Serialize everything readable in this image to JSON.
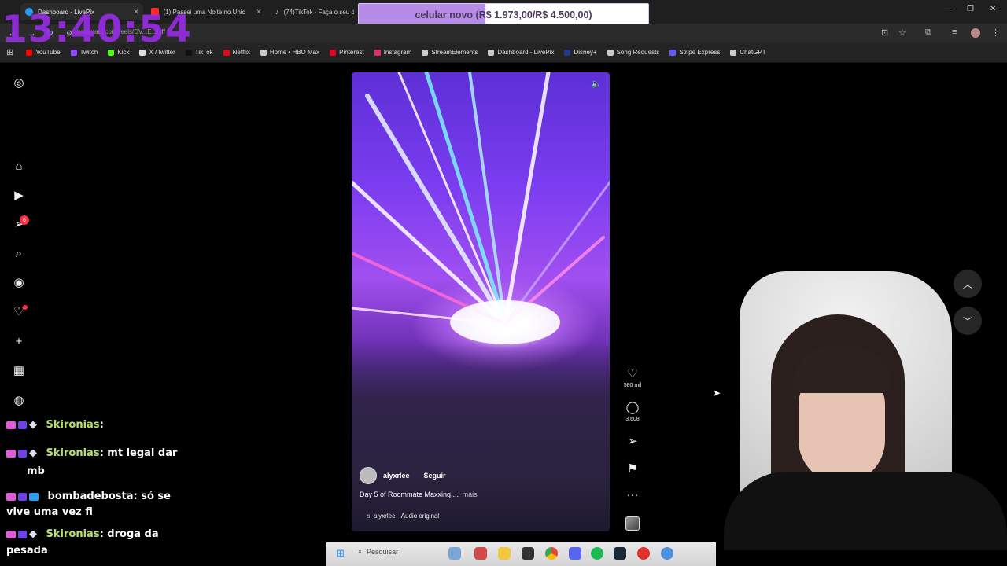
{
  "clock": "13:40:54",
  "browser": {
    "tabs": [
      {
        "title": "Dashboard - LivePix",
        "color": "#2b9bf4"
      },
      {
        "title": "(1) Passei uma Noite no Único",
        "color": "#ff2a2a"
      },
      {
        "title": "(74)TikTok - Faça o seu di",
        "color": "#222222"
      }
    ],
    "url": "instagram.com/reels/DV...E...Gf/"
  },
  "donation": {
    "text": "celular novo (R$ 1.973,00/R$ 4.500,00)",
    "progress_fraction": 0.4384,
    "fill_color": "#b78be8"
  },
  "bookmarks": [
    {
      "label": "YouTube",
      "color": "#ff0000"
    },
    {
      "label": "Twitch",
      "color": "#9146ff"
    },
    {
      "label": "Kick",
      "color": "#53fc18"
    },
    {
      "label": "X / twitter",
      "color": "#dddddd"
    },
    {
      "label": "TikTok",
      "color": "#111111"
    },
    {
      "label": "Netflix",
      "color": "#e50914"
    },
    {
      "label": "Home • HBO Max",
      "color": "#cccccc"
    },
    {
      "label": "Pinterest",
      "color": "#e60023"
    },
    {
      "label": "Instagram",
      "color": "#e1306c"
    },
    {
      "label": "StreamElements",
      "color": "#cccccc"
    },
    {
      "label": "Dashboard - LivePix",
      "color": "#cccccc"
    },
    {
      "label": "Disney+",
      "color": "#1a3a8c"
    },
    {
      "label": "Song Requests",
      "color": "#cccccc"
    },
    {
      "label": "Stripe Express",
      "color": "#635bff"
    },
    {
      "label": "ChatGPT",
      "color": "#cccccc"
    }
  ],
  "sidebar": {
    "notification_count": "6"
  },
  "reel": {
    "username": "alyxrlee",
    "follow_label": "Seguir",
    "caption": "Day 5 of Roommate Maxxing ...",
    "more_label": "mais",
    "audio": "alyxrlee · Áudio original",
    "likes": "580 mil",
    "comments": "3.608"
  },
  "chat": [
    {
      "user": "Skironias",
      "text": "",
      "user_color": "#b9e06a"
    },
    {
      "user": "Skironias",
      "text": "mt legal dar",
      "cont": "mb",
      "user_color": "#b9e06a"
    },
    {
      "user": "bombadebosta",
      "text": "só se",
      "cont": "vive uma vez fi",
      "user_color": "#ffffff"
    },
    {
      "user": "Skironias",
      "text": "droga da",
      "cont": "pesada",
      "user_color": "#b9e06a"
    }
  ],
  "taskbar": {
    "search_placeholder": "Pesquisar"
  }
}
